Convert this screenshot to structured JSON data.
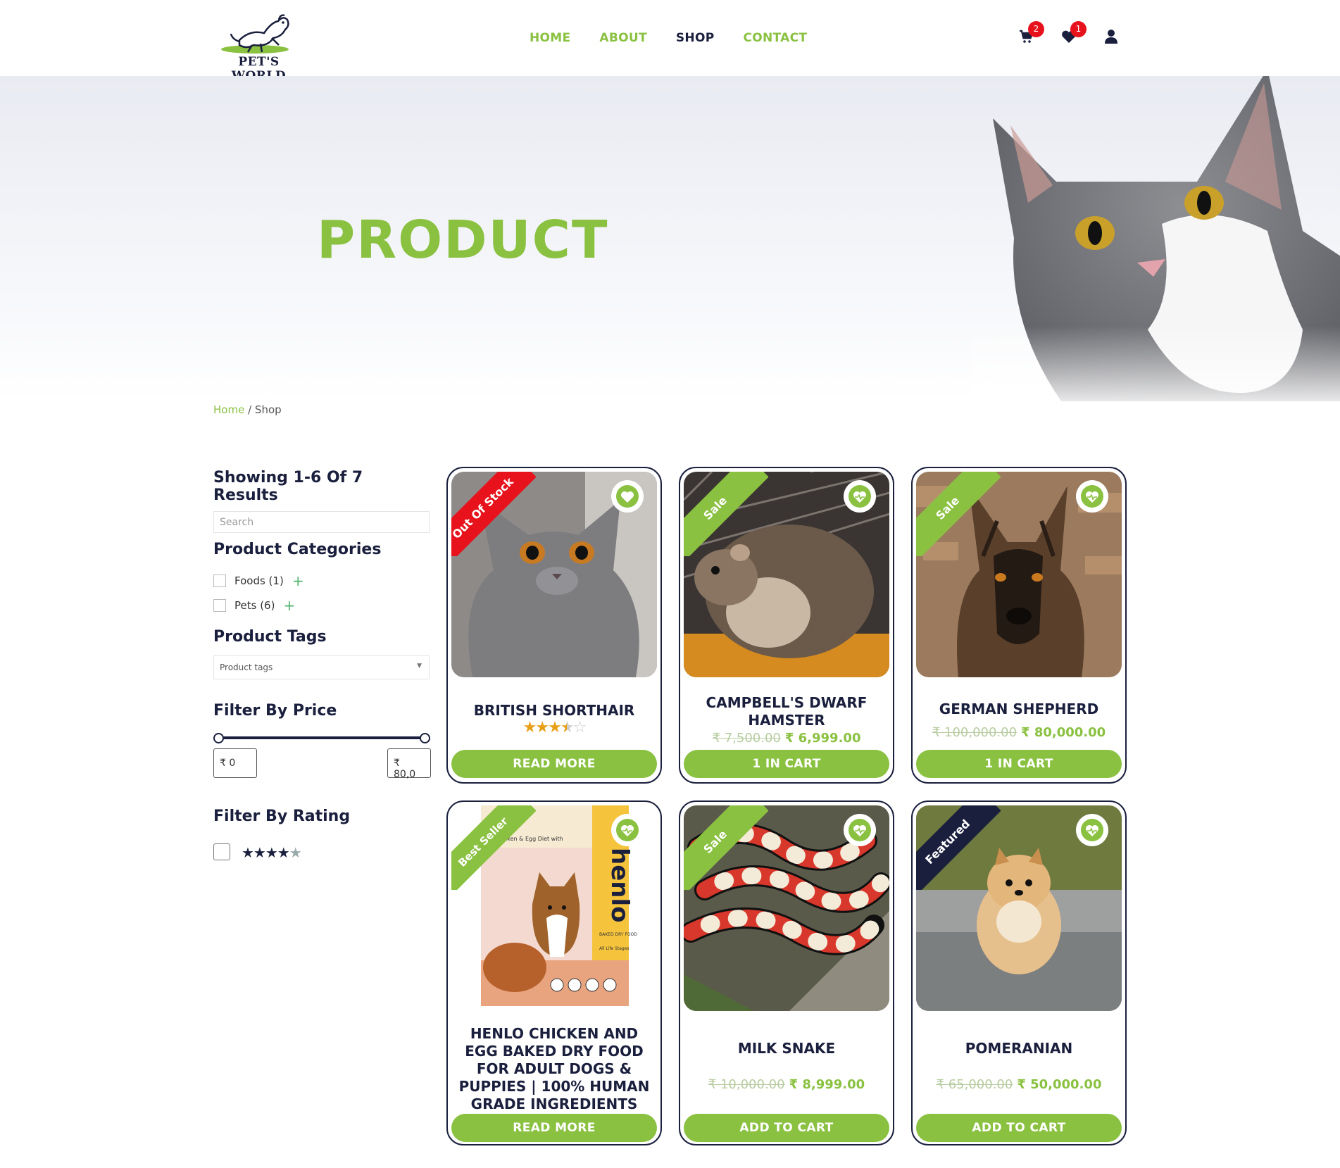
{
  "brand": {
    "logo_text": "PET'S WORLD"
  },
  "nav": {
    "items": [
      {
        "label": "HOME",
        "active": false
      },
      {
        "label": "ABOUT",
        "active": false
      },
      {
        "label": "SHOP",
        "active": true
      },
      {
        "label": "CONTACT",
        "active": false
      }
    ]
  },
  "header_icons": {
    "cart_count": "2",
    "wishlist_count": "1"
  },
  "hero": {
    "title": "PRODUCT"
  },
  "breadcrumb": {
    "home": "Home",
    "sep": "/",
    "current": "Shop"
  },
  "sidebar": {
    "results": "Showing 1-6 Of 7 Results",
    "search_placeholder": "Search",
    "categories_title": "Product Categories",
    "categories": [
      {
        "label": "Foods (1)"
      },
      {
        "label": "Pets (6)"
      }
    ],
    "tags_title": "Product Tags",
    "tags_placeholder": "Product tags",
    "price_title": "Filter By Price",
    "price_min": "₹ 0",
    "price_max": "₹ 80,0",
    "rating_title": "Filter By Rating",
    "rating_filter": 4
  },
  "colors": {
    "accent": "#8ac141",
    "navy": "#1a1f3d",
    "badge": "#e8121c"
  },
  "products": [
    {
      "name": "BRITISH SHORTHAIR",
      "ribbon": "Out Of Stock",
      "ribbon_color": "#e8121c",
      "rating": 3.5,
      "old_price": "",
      "price": "",
      "button": "READ MORE"
    },
    {
      "name": "CAMPBELL'S DWARF HAMSTER",
      "ribbon": "Sale",
      "ribbon_color": "#8ac141",
      "old_price": "₹ 7,500.00",
      "price": "₹ 6,999.00",
      "button": "1 IN CART"
    },
    {
      "name": "GERMAN SHEPHERD",
      "ribbon": "Sale",
      "ribbon_color": "#8ac141",
      "old_price": "₹ 100,000.00",
      "price": "₹ 80,000.00",
      "button": "1 IN CART"
    },
    {
      "name": "HENLO CHICKEN AND EGG BAKED DRY FOOD FOR ADULT DOGS & PUPPIES | 100% HUMAN GRADE INGREDIENTS",
      "ribbon": "Best Seller",
      "ribbon_color": "#8ac141",
      "old_price": "",
      "price": "",
      "button": "READ MORE"
    },
    {
      "name": "MILK SNAKE",
      "ribbon": "Sale",
      "ribbon_color": "#8ac141",
      "old_price": "₹ 10,000.00",
      "price": "₹ 8,999.00",
      "button": "ADD TO CART"
    },
    {
      "name": "POMERANIAN",
      "ribbon": "Featured",
      "ribbon_color": "#1a1f3d",
      "old_price": "₹ 65,000.00",
      "price": "₹ 50,000.00",
      "button": "ADD TO CART"
    }
  ],
  "package": {
    "brand": "henlo",
    "headline": "Chicken & Egg Diet with",
    "label": "BAKED DRY FOOD",
    "sub": "All Life Stages"
  }
}
